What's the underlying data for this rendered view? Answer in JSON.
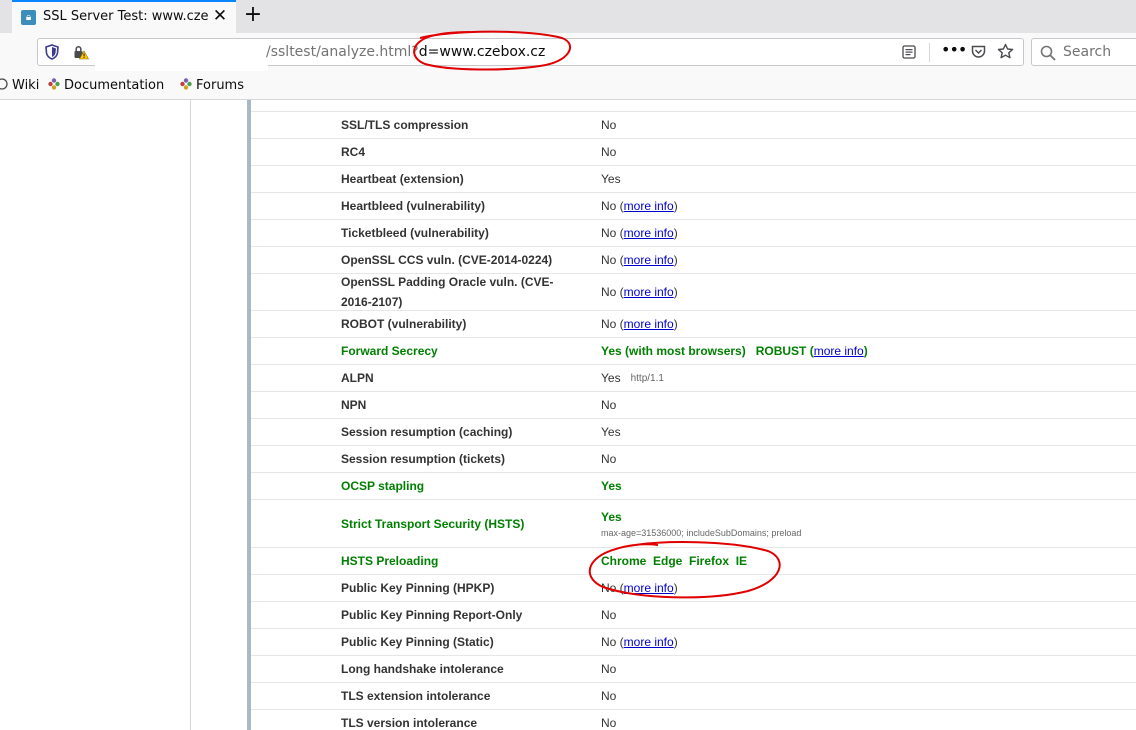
{
  "tab": {
    "title": "SSL Server Test: www.cze",
    "close": "✕"
  },
  "newtab": "+",
  "urlbar": {
    "path": "/ssltest/analyze.html?",
    "query": "d=www.czebox.cz"
  },
  "search": {
    "placeholder": "Search"
  },
  "bookmarks": [
    {
      "label": "Wiki"
    },
    {
      "label": "Documentation"
    },
    {
      "label": "Forums"
    }
  ],
  "rows": [
    {
      "key": "SSL/TLS compression",
      "value": "No"
    },
    {
      "key": "RC4",
      "value": "No"
    },
    {
      "key": "Heartbeat (extension)",
      "value": "Yes"
    },
    {
      "key": "Heartbleed (vulnerability)",
      "value": "No (",
      "link": "more info",
      "tail": ")"
    },
    {
      "key": "Ticketbleed (vulnerability)",
      "value": "No (",
      "link": "more info",
      "tail": ")"
    },
    {
      "key": "OpenSSL CCS vuln. (CVE-2014-0224)",
      "value": "No (",
      "link": "more info",
      "tail": ")"
    },
    {
      "key": "OpenSSL Padding Oracle vuln. (CVE-2016-2107)",
      "value": "No (",
      "link": "more info",
      "tail": ")"
    },
    {
      "key": "ROBOT (vulnerability)",
      "value": "No (",
      "link": "more info",
      "tail": ")"
    },
    {
      "key": "Forward Secrecy",
      "value": "Yes (with most browsers)   ROBUST (",
      "link": "more info",
      "tail": ")"
    },
    {
      "key": "ALPN",
      "value": "Yes",
      "small": "http/1.1"
    },
    {
      "key": "NPN",
      "value": "No"
    },
    {
      "key": "Session resumption (caching)",
      "value": "Yes"
    },
    {
      "key": "Session resumption (tickets)",
      "value": "No"
    },
    {
      "key": "OCSP stapling",
      "value": "Yes"
    },
    {
      "key": "Strict Transport Security (HSTS)",
      "value": "Yes",
      "detail": "max-age=31536000; includeSubDomains; preload"
    },
    {
      "key": "HSTS Preloading",
      "value": "Chrome  Edge  Firefox  IE"
    },
    {
      "key": "Public Key Pinning (HPKP)",
      "value": "No (",
      "link": "more info",
      "tail": ")"
    },
    {
      "key": "Public Key Pinning Report-Only",
      "value": "No"
    },
    {
      "key": "Public Key Pinning (Static)",
      "value": "No (",
      "link": "more info",
      "tail": ")"
    },
    {
      "key": "Long handshake intolerance",
      "value": "No"
    },
    {
      "key": "TLS extension intolerance",
      "value": "No"
    },
    {
      "key": "TLS version intolerance",
      "value": "No"
    }
  ]
}
